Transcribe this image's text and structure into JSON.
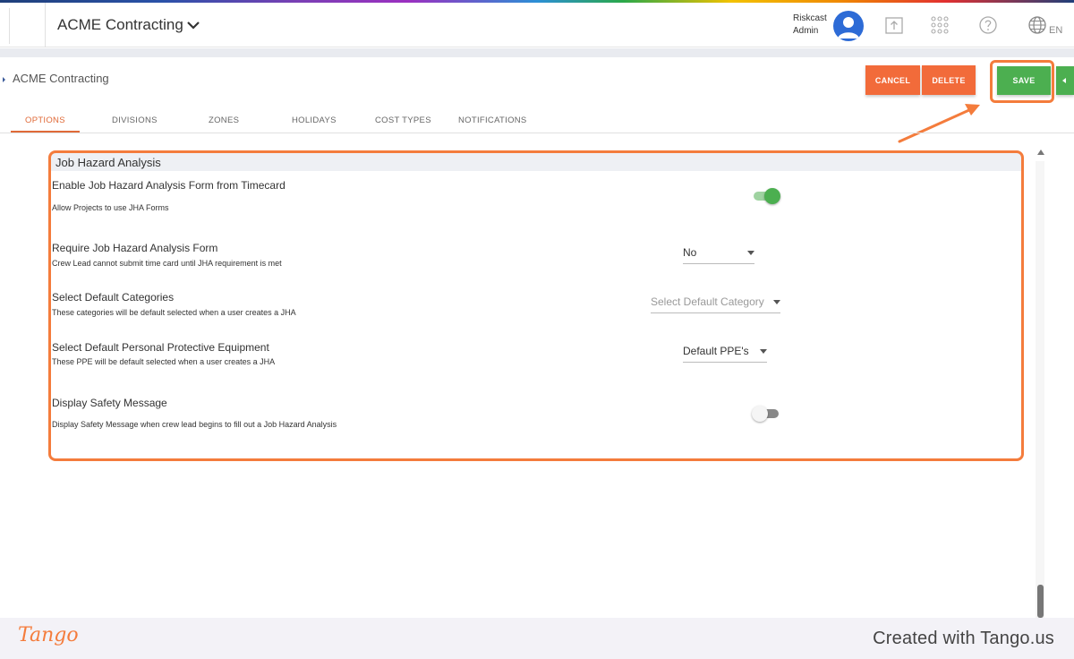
{
  "header": {
    "org_name": "ACME Contracting",
    "user_org": "Riskcast",
    "user_role": "Admin",
    "language": "EN",
    "icons": [
      "chevron-down-icon",
      "upload-icon",
      "apps-grid-icon",
      "help-icon",
      "globe-icon"
    ]
  },
  "subheader": {
    "breadcrumb": "ACME Contracting",
    "cancel_label": "CANCEL",
    "delete_label": "DELETE",
    "save_label": "SAVE"
  },
  "tabs": [
    {
      "label": "OPTIONS",
      "active": true
    },
    {
      "label": "DIVISIONS",
      "active": false
    },
    {
      "label": "ZONES",
      "active": false
    },
    {
      "label": "HOLIDAYS",
      "active": false
    },
    {
      "label": "COST TYPES",
      "active": false
    },
    {
      "label": "NOTIFICATIONS",
      "active": false
    }
  ],
  "section": {
    "title": "Job Hazard Analysis",
    "rows": [
      {
        "title": "Enable Job Hazard Analysis Form from Timecard",
        "desc": "Allow Projects to use JHA Forms",
        "control": "toggle",
        "on": true
      },
      {
        "title": "Require Job Hazard Analysis Form",
        "desc": "Crew Lead cannot submit time card until JHA requirement is met",
        "control": "select",
        "value": "No"
      },
      {
        "title": "Select Default Categories",
        "desc": "These categories will be default selected when a user creates a JHA",
        "control": "select",
        "placeholder": "Select Default Category"
      },
      {
        "title": "Select Default Personal Protective Equipment",
        "desc": "These PPE will be default selected when a user creates a JHA",
        "control": "select",
        "value": "Default PPE's"
      },
      {
        "title": "Display Safety Message",
        "desc": "Display Safety Message when crew lead begins to fill out a Job Hazard Analysis",
        "control": "toggle",
        "on": false
      }
    ]
  },
  "footer": {
    "logo": "Tango",
    "credit": "Created with Tango.us"
  },
  "colors": {
    "accent_orange": "#f47c3c",
    "save_green": "#4caf50",
    "danger_orange": "#f26b3a",
    "avatar_blue": "#2d6bd6"
  }
}
